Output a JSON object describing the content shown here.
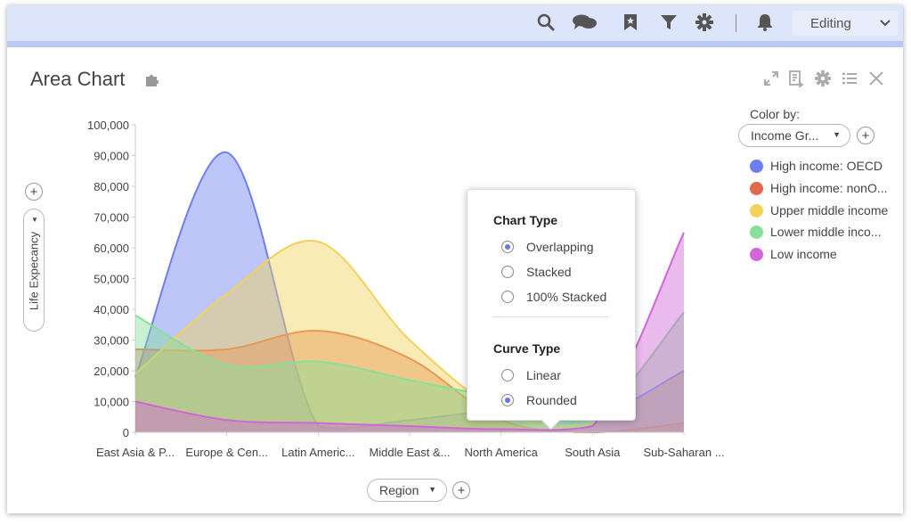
{
  "toolbar": {
    "icons": [
      "search-icon",
      "chat-icon",
      "bookmark-icon",
      "filter-icon",
      "gear-icon",
      "bell-icon"
    ],
    "mode_label": "Editing"
  },
  "widget": {
    "title": "Area Chart",
    "tools": [
      "expand-icon",
      "export-icon",
      "settings-icon",
      "list-icon",
      "close-icon"
    ]
  },
  "y_field": "Life Expecancy",
  "x_field": "Region",
  "legend": {
    "title": "Color by:",
    "field": "Income Gr...",
    "items": [
      {
        "label": "High income: OECD",
        "color": "#6e7ef0"
      },
      {
        "label": "High income: nonO...",
        "color": "#e06a4e"
      },
      {
        "label": "Upper middle income",
        "color": "#f2d25a"
      },
      {
        "label": "Lower middle inco...",
        "color": "#86e09a"
      },
      {
        "label": "Low income",
        "color": "#d266d8"
      }
    ]
  },
  "popup": {
    "chart_type_label": "Chart Type",
    "chart_type_options": [
      "Overlapping",
      "Stacked",
      "100% Stacked"
    ],
    "chart_type_selected": "Overlapping",
    "curve_type_label": "Curve Type",
    "curve_type_options": [
      "Linear",
      "Rounded"
    ],
    "curve_type_selected": "Rounded"
  },
  "chart_data": {
    "type": "area",
    "categories": [
      "East Asia & P...",
      "Europe & Cen...",
      "Latin Americ...",
      "Middle East &...",
      "North America",
      "South Asia",
      "Sub-Saharan ..."
    ],
    "ylim": [
      0,
      100000
    ],
    "yticks": [
      0,
      10000,
      20000,
      30000,
      40000,
      50000,
      60000,
      70000,
      80000,
      90000,
      100000
    ],
    "ytick_labels": [
      "0",
      "10,000",
      "20,000",
      "30,000",
      "40,000",
      "50,000",
      "60,000",
      "70,000",
      "80,000",
      "90,000",
      "100,000"
    ],
    "curve": "rounded",
    "mode": "overlapping",
    "series": [
      {
        "name": "High income: OECD",
        "color": "#6e7ef0",
        "values": [
          18000,
          91000,
          2000,
          4000,
          7000,
          5000,
          20000
        ]
      },
      {
        "name": "High income: nonO...",
        "color": "#e06a4e",
        "values": [
          27000,
          27000,
          33000,
          24000,
          4000,
          0,
          3000
        ]
      },
      {
        "name": "Upper middle income",
        "color": "#f2d25a",
        "values": [
          19000,
          45000,
          62000,
          30000,
          7000,
          3000,
          19000
        ]
      },
      {
        "name": "Lower middle inco...",
        "color": "#86e09a",
        "values": [
          38000,
          22000,
          23000,
          17000,
          11000,
          5000,
          39000
        ]
      },
      {
        "name": "Low income",
        "color": "#d266d8",
        "values": [
          10000,
          4000,
          3000,
          2000,
          1000,
          2000,
          65000
        ]
      }
    ]
  }
}
